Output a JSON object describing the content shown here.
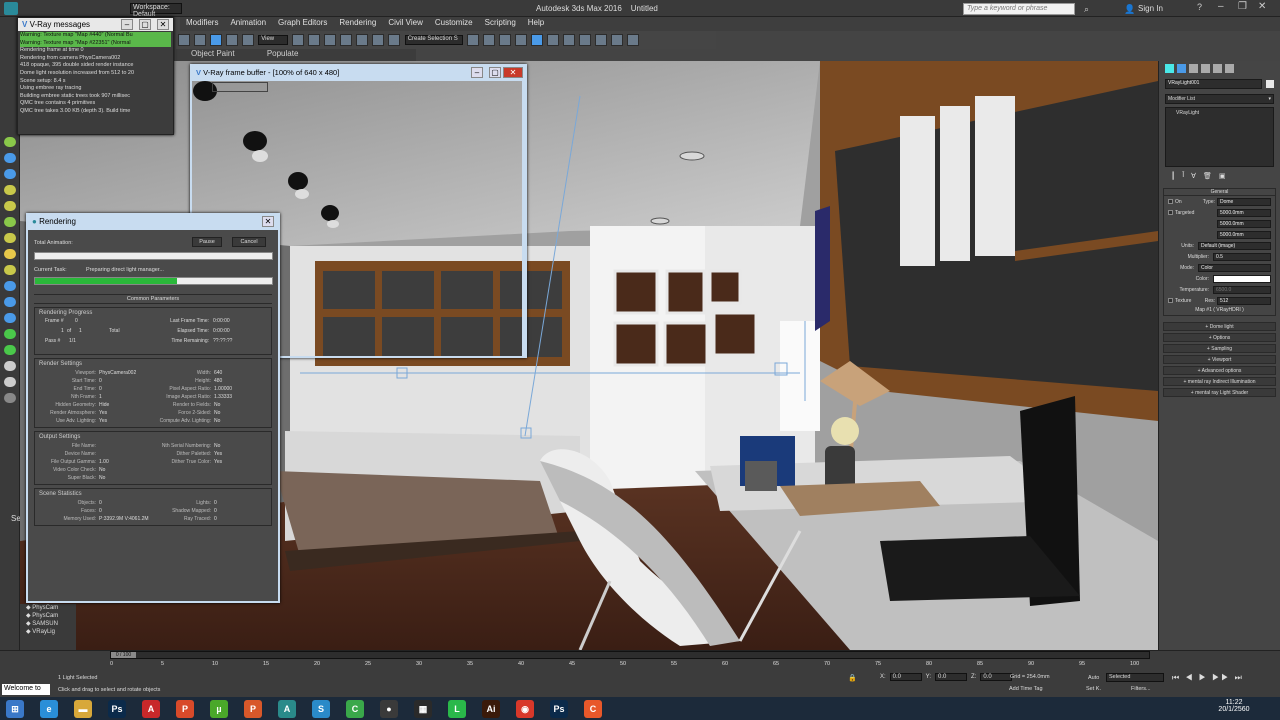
{
  "app": {
    "title": "Autodesk 3ds Max 2016",
    "doc": "Untitled",
    "workspace": "Workspace: Default",
    "search_placeholder": "Type a keyword or phrase",
    "sign_in": "Sign In"
  },
  "menu": [
    "Modifiers",
    "Animation",
    "Graph Editors",
    "Rendering",
    "Civil View",
    "Customize",
    "Scripting",
    "Help"
  ],
  "ribbon": {
    "tab1": "Object Paint",
    "tab2": "Populate"
  },
  "toolbar": {
    "view_dropdown": "View",
    "selection_set": "Create Selection S"
  },
  "vray_msgs": {
    "title": "V-Ray messages",
    "lines": [
      {
        "text": "Warning: Texture map \"Map #440\" (Normal Bu",
        "warn": true
      },
      {
        "text": "Warning: Texture map \"Map #22351\" (Normal",
        "warn": true
      },
      {
        "text": "Rendering frame at time 0",
        "warn": false
      },
      {
        "text": "Rendering from camera PhysCamera002",
        "warn": false
      },
      {
        "text": "418 opaque, 395 double sided render instance",
        "warn": false
      },
      {
        "text": "Dome light resolution increased from 512 to 20",
        "warn": false
      },
      {
        "text": "Scene setup: 8.4 s",
        "warn": false
      },
      {
        "text": "Using embree ray tracing",
        "warn": false
      },
      {
        "text": "Building embree static trees took 907 millisec",
        "warn": false
      },
      {
        "text": "QMC tree contains 4 primitives",
        "warn": false
      },
      {
        "text": "QMC tree takes 3.00 KB (depth 3). Build time",
        "warn": false
      }
    ]
  },
  "vfb": {
    "title": "V-Ray frame buffer - [100% of 640 x 480]"
  },
  "rendering": {
    "title": "Rendering",
    "total_animation": "Total Animation:",
    "pause": "Pause",
    "cancel": "Cancel",
    "current_task_label": "Current Task:",
    "current_task": "Preparing direct light manager...",
    "progress": 0.6,
    "common_params": "Common Parameters",
    "progress_group": "Rendering Progress",
    "frame_label": "Frame #",
    "frame_val": "0",
    "of_label": "of",
    "one": "1",
    "total_label": "Total",
    "pass_label": "Pass #",
    "pass_val": "1/1",
    "last_frame_label": "Last Frame Time:",
    "last_frame_val": "0:00:00",
    "elapsed_label": "Elapsed Time:",
    "elapsed_val": "0:00:00",
    "remaining_label": "Time Remaining:",
    "remaining_val": "??:??:??",
    "render_settings": "Render Settings",
    "rs_left": [
      [
        "Viewport:",
        "PhysCamera002"
      ],
      [
        "Start Time:",
        "0"
      ],
      [
        "End Time:",
        "0"
      ],
      [
        "Nth Frame:",
        "1"
      ],
      [
        "Hidden Geometry:",
        "Hide"
      ],
      [
        "Render Atmosphere:",
        "Yes"
      ],
      [
        "Use Adv. Lighting:",
        "Yes"
      ]
    ],
    "rs_right": [
      [
        "Width:",
        "640"
      ],
      [
        "Height:",
        "480"
      ],
      [
        "Pixel Aspect Ratio:",
        "1.00000"
      ],
      [
        "Image Aspect Ratio:",
        "1.33333"
      ],
      [
        "Render to Fields:",
        "No"
      ],
      [
        "Force 2-Sided:",
        "No"
      ],
      [
        "Compute Adv. Lighting:",
        "No"
      ]
    ],
    "output_settings": "Output Settings",
    "os_left": [
      [
        "File Name:",
        ""
      ],
      [
        "Device Name:",
        ""
      ],
      [
        "File Output Gamma:",
        "1.00"
      ],
      [
        "Video Color Check:",
        "No"
      ],
      [
        "Super Black:",
        "No"
      ]
    ],
    "os_right": [
      [
        "",
        ""
      ],
      [
        "",
        ""
      ],
      [
        "Nth Serial Numbering:",
        "No"
      ],
      [
        "Dither Paletted:",
        "Yes"
      ],
      [
        "Dither True Color:",
        "Yes"
      ]
    ],
    "scene_stats": "Scene Statistics",
    "ss_left": [
      [
        "Objects:",
        "0"
      ],
      [
        "Faces:",
        "0"
      ],
      [
        "Memory Used:",
        "P:3392.9M V:4061.2M"
      ]
    ],
    "ss_right": [
      [
        "Lights:",
        "0"
      ],
      [
        "Shadow Mapped:",
        "0"
      ],
      [
        "Ray Traced:",
        "0"
      ]
    ]
  },
  "cmd": {
    "name": "VRayLight001",
    "modifier_list": "Modifier List",
    "stack_item": "VRayLight",
    "general": "General",
    "on": "On",
    "type_label": "Type:",
    "type_val": "Dome",
    "targeted": "Targeted",
    "size1": "5000.0mm",
    "size2": "5000.0mm",
    "size3": "5000.0mm",
    "units_label": "Units:",
    "units_val": "Default (image)",
    "multiplier_label": "Multiplier:",
    "multiplier_val": "0.5",
    "mode_label": "Mode:",
    "mode_val": "Color",
    "color_label": "Color:",
    "temperature_label": "Temperature:",
    "temperature_val": "6500.0",
    "texture_label": "Texture",
    "res_label": "Res:",
    "res_val": "512",
    "map_label": "Map #1 ( VRayHDRI )",
    "rollouts": [
      "Dome light",
      "Options",
      "Sampling",
      "Viewport",
      "Advanced options",
      "mental ray Indirect Illumination",
      "mental ray Light Shader"
    ]
  },
  "scene_list": [
    "PhysCam",
    "PhysCam",
    "SAMSUN",
    "VRayLig"
  ],
  "timeline": {
    "counter": "0 / 100",
    "ticks": [
      "0",
      "5",
      "10",
      "15",
      "20",
      "25",
      "30",
      "35",
      "40",
      "45",
      "50",
      "55",
      "60",
      "65",
      "70",
      "75",
      "80",
      "85",
      "90",
      "95",
      "100"
    ]
  },
  "status": {
    "welcome": "Welcome to",
    "selected": "1 Light Selected",
    "prompt": "Click and drag to select and rotate objects",
    "x_label": "X:",
    "x_val": "0.0",
    "y_label": "Y:",
    "y_val": "0.0",
    "z_label": "Z:",
    "z_val": "0.0",
    "grid": "Grid = 254.0mm",
    "add_time_tag": "Add Time Tag",
    "auto": "Auto",
    "set_k": "Set K.",
    "selected_dd": "Selected",
    "filters": "Filters...",
    "left_label": "Sele"
  },
  "clock": {
    "time": "11:22",
    "date": "20/1/2560"
  },
  "taskbar_icons": [
    {
      "name": "windows-start-icon",
      "label": "⊞",
      "color": "#3a78c8"
    },
    {
      "name": "ie-icon",
      "label": "e",
      "color": "#2a8fd8"
    },
    {
      "name": "folder-icon",
      "label": "▬",
      "color": "#d8a83a"
    },
    {
      "name": "photoshop-icon",
      "label": "Ps",
      "color": "#0b2a4a"
    },
    {
      "name": "acrobat-icon",
      "label": "A",
      "color": "#c8282a"
    },
    {
      "name": "pdf-icon",
      "label": "P",
      "color": "#d84a2a"
    },
    {
      "name": "utorrent-icon",
      "label": "µ",
      "color": "#4aa82a"
    },
    {
      "name": "powerpoint-icon",
      "label": "P",
      "color": "#d8582a"
    },
    {
      "name": "autocad-icon",
      "label": "A",
      "color": "#2a8a8a"
    },
    {
      "name": "sketchup-icon",
      "label": "S",
      "color": "#2a8ac8"
    },
    {
      "name": "camtasia-icon",
      "label": "C",
      "color": "#3aa84a"
    },
    {
      "name": "obs-icon",
      "label": "●",
      "color": "#3a3a3a"
    },
    {
      "name": "film-icon",
      "label": "▦",
      "color": "#2a2a2a"
    },
    {
      "name": "line-icon",
      "label": "L",
      "color": "#2ab84a"
    },
    {
      "name": "illustrator-icon",
      "label": "Ai",
      "color": "#3a1a0a"
    },
    {
      "name": "chrome-icon",
      "label": "◉",
      "color": "#d8382a"
    },
    {
      "name": "photoshop2-icon",
      "label": "Ps",
      "color": "#0b2a4a"
    },
    {
      "name": "app-icon",
      "label": "C",
      "color": "#e8582a"
    }
  ]
}
